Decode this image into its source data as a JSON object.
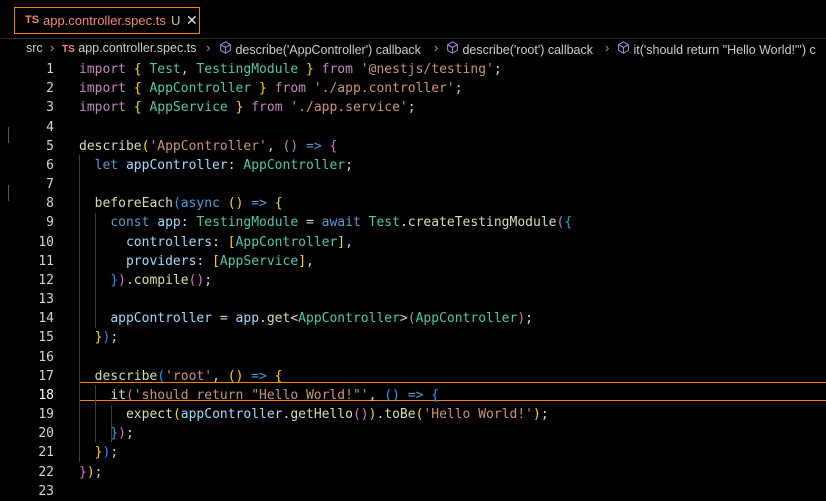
{
  "tab": {
    "lang_badge": "TS",
    "filename": "app.controller.spec.ts",
    "status": "U",
    "close": "✕"
  },
  "breadcrumb": {
    "folder": "src",
    "file_badge": "TS",
    "file": "app.controller.spec.ts",
    "symbol1": "describe('AppController') callback",
    "symbol2": "describe('root') callback",
    "symbol3": "it('should return \"Hello World!\"') c"
  },
  "editor": {
    "active_line": 18,
    "line_numbers": [
      "1",
      "2",
      "3",
      "4",
      "5",
      "6",
      "7",
      "8",
      "9",
      "10",
      "11",
      "12",
      "13",
      "14",
      "15",
      "16",
      "17",
      "18",
      "19",
      "20",
      "21",
      "22",
      "23"
    ],
    "lines": [
      "import { Test, TestingModule } from '@nestjs/testing';",
      "import { AppController } from './app.controller';",
      "import { AppService } from './app.service';",
      "",
      "describe('AppController', () => {",
      "  let appController: AppController;",
      "",
      "  beforeEach(async () => {",
      "    const app: TestingModule = await Test.createTestingModule({",
      "      controllers: [AppController],",
      "      providers: [AppService],",
      "    }).compile();",
      "",
      "    appController = app.get<AppController>(AppController);",
      "  });",
      "",
      "  describe('root', () => {",
      "    it('should return \"Hello World!\"', () => {",
      "      expect(appController.getHello()).toBe('Hello World!');",
      "    });",
      "  });",
      "});",
      ""
    ]
  },
  "colors": {
    "keyword": "#569cd6",
    "control": "#c586c0",
    "type": "#4ec9b0",
    "string": "#ce9178",
    "function": "#dcdcaa",
    "variable": "#9cdcfe",
    "bracket1": "#ffd700",
    "bracket2": "#da70d6",
    "bracket3": "#179fff",
    "tab_border": "#f38518",
    "tab_text": "#f48771"
  }
}
